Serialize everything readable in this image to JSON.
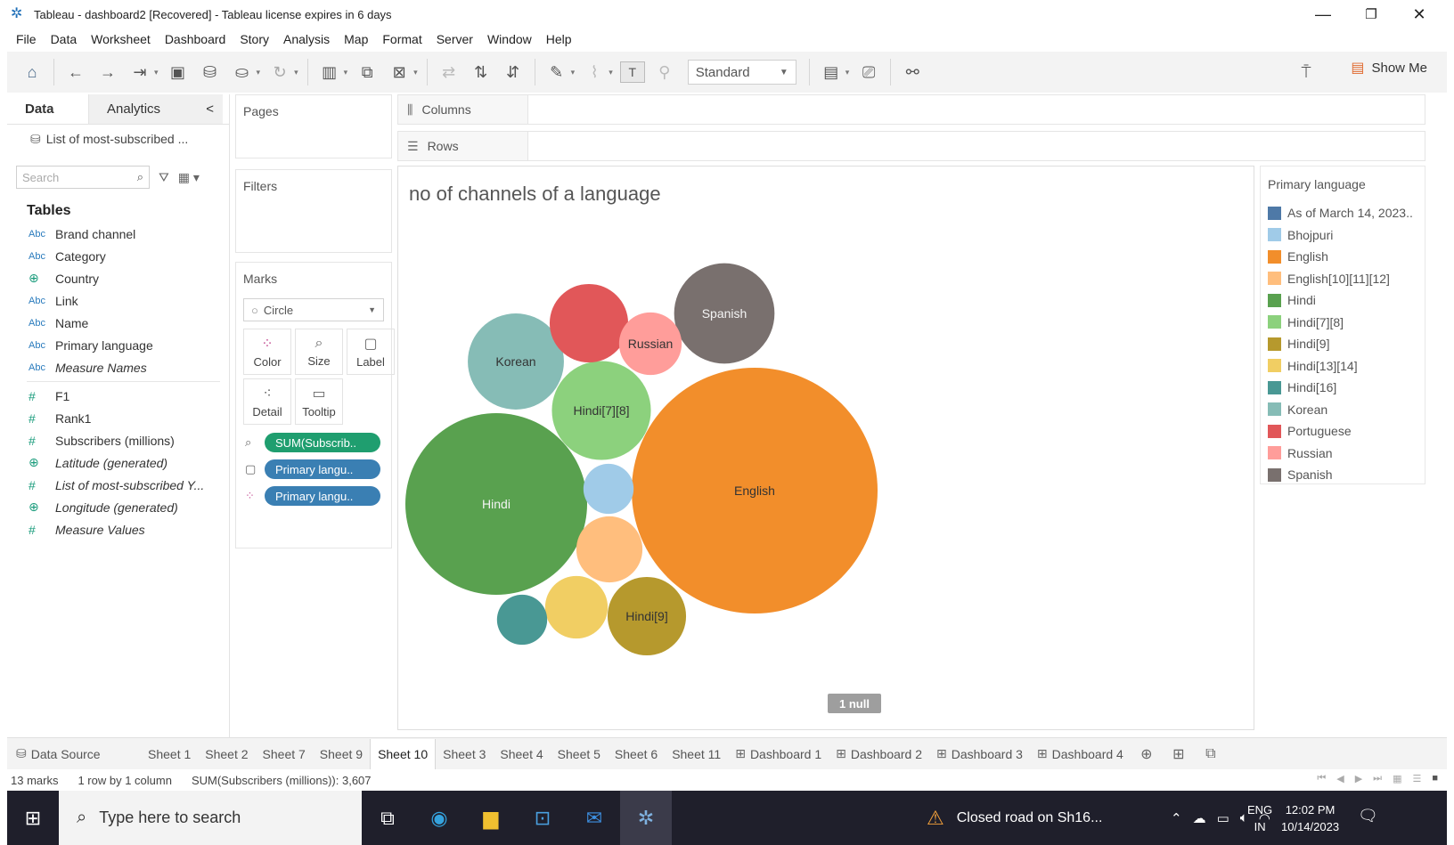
{
  "window": {
    "title": "Tableau - dashboard2 [Recovered] - Tableau license expires in 6 days",
    "app_icon": "tableau-logo-icon",
    "controls": [
      "—",
      "❐",
      "✕"
    ]
  },
  "menu": [
    "File",
    "Data",
    "Worksheet",
    "Dashboard",
    "Story",
    "Analysis",
    "Map",
    "Format",
    "Server",
    "Window",
    "Help"
  ],
  "toolbar": {
    "fit_select": "Standard",
    "show_me": "Show Me"
  },
  "data_pane": {
    "tab_data": "Data",
    "tab_analytics": "Analytics",
    "collapse_glyph": "<",
    "datasource": "List of most-subscribed ...",
    "search_placeholder": "Search",
    "tables_heading": "Tables",
    "dimensions": [
      {
        "type": "Abc",
        "name": "Brand channel",
        "italic": false
      },
      {
        "type": "Abc",
        "name": "Category",
        "italic": false
      },
      {
        "type": "globe",
        "name": "Country",
        "italic": false
      },
      {
        "type": "Abc",
        "name": "Link",
        "italic": false
      },
      {
        "type": "Abc",
        "name": "Name",
        "italic": false
      },
      {
        "type": "Abc",
        "name": "Primary language",
        "italic": false
      },
      {
        "type": "Abc",
        "name": "Measure Names",
        "italic": true
      }
    ],
    "measures": [
      {
        "type": "#",
        "name": "F1",
        "italic": false
      },
      {
        "type": "#",
        "name": "Rank1",
        "italic": false
      },
      {
        "type": "#",
        "name": "Subscribers (millions)",
        "italic": false
      },
      {
        "type": "globe",
        "name": "Latitude (generated)",
        "italic": true
      },
      {
        "type": "#",
        "name": "List of most-subscribed Y...",
        "italic": true
      },
      {
        "type": "globe",
        "name": "Longitude (generated)",
        "italic": true
      },
      {
        "type": "#",
        "name": "Measure Values",
        "italic": true
      }
    ]
  },
  "cards": {
    "pages": "Pages",
    "filters": "Filters",
    "marks": "Marks",
    "mark_type": "Circle",
    "mark_buttons": [
      {
        "label": "Color",
        "icon": "color-dots-icon"
      },
      {
        "label": "Size",
        "icon": "size-icon"
      },
      {
        "label": "Label",
        "icon": "label-icon"
      },
      {
        "label": "Detail",
        "icon": "detail-icon"
      },
      {
        "label": "Tooltip",
        "icon": "tooltip-icon"
      }
    ],
    "pills": [
      {
        "label": "SUM(Subscrib..",
        "color": "green",
        "icon": "size-icon"
      },
      {
        "label": "Primary langu..",
        "color": "blue",
        "icon": "label-icon"
      },
      {
        "label": "Primary langu..",
        "color": "blue",
        "icon": "color-dots-icon"
      }
    ]
  },
  "shelves": {
    "columns": "Columns",
    "rows": "Rows"
  },
  "viz": {
    "title": "no of channels of a language",
    "null_indicator": "1 null"
  },
  "chart_data": {
    "type": "packed-bubble",
    "title": "no of channels of a language",
    "size_measure": "SUM(Subscribers (millions))",
    "color_dimension": "Primary language",
    "total": 3607,
    "bubbles": [
      {
        "language": "English",
        "label": "English",
        "value": 1080,
        "color": "#f28e2b"
      },
      {
        "language": "Hindi",
        "label": "Hindi",
        "value": 590,
        "color": "#59a14f"
      },
      {
        "language": "Hindi[7][8]",
        "label": "Hindi[7][8]",
        "value": 175,
        "color": "#8cd17d"
      },
      {
        "language": "Korean",
        "label": "Korean",
        "value": 165,
        "color": "#86bcb6"
      },
      {
        "language": "Spanish",
        "label": "Spanish",
        "value": 180,
        "color": "#79706e"
      },
      {
        "language": "Hindi[9]",
        "label": "Hindi[9]",
        "value": 110,
        "color": "#b6992d"
      },
      {
        "language": "Portuguese",
        "label": "",
        "value": 110,
        "color": "#e15759"
      },
      {
        "language": "English[10][11][12]",
        "label": "",
        "value": 78,
        "color": "#ffbe7d"
      },
      {
        "language": "Russian",
        "label": "Russian",
        "value": 70,
        "color": "#ff9d9a"
      },
      {
        "language": "Hindi[13][14]",
        "label": "",
        "value": 70,
        "color": "#f1ce63"
      },
      {
        "language": "Hindi[16]",
        "label": "",
        "value": 45,
        "color": "#499894"
      },
      {
        "language": "Bhojpuri",
        "label": "",
        "value": 45,
        "color": "#a0cbe8"
      }
    ]
  },
  "legend": {
    "title": "Primary language",
    "items": [
      {
        "label": "As of March 14, 2023..",
        "color": "#4e79a7"
      },
      {
        "label": "Bhojpuri",
        "color": "#a0cbe8"
      },
      {
        "label": "English",
        "color": "#f28e2b"
      },
      {
        "label": "English[10][11][12]",
        "color": "#ffbe7d"
      },
      {
        "label": "Hindi",
        "color": "#59a14f"
      },
      {
        "label": "Hindi[7][8]",
        "color": "#8cd17d"
      },
      {
        "label": "Hindi[9]",
        "color": "#b6992d"
      },
      {
        "label": "Hindi[13][14]",
        "color": "#f1ce63"
      },
      {
        "label": "Hindi[16]",
        "color": "#499894"
      },
      {
        "label": "Korean",
        "color": "#86bcb6"
      },
      {
        "label": "Portuguese",
        "color": "#e15759"
      },
      {
        "label": "Russian",
        "color": "#ff9d9a"
      },
      {
        "label": "Spanish",
        "color": "#79706e"
      }
    ]
  },
  "sheet_tabs": {
    "data_source": "Data Source",
    "sheets": [
      "Sheet 1",
      "Sheet 2",
      "Sheet 7",
      "Sheet 9",
      "Sheet 10",
      "Sheet 3",
      "Sheet 4",
      "Sheet 5",
      "Sheet 6",
      "Sheet 11"
    ],
    "active": "Sheet 10",
    "dashboards": [
      "Dashboard 1",
      "Dashboard 2",
      "Dashboard 3",
      "Dashboard 4"
    ]
  },
  "status": {
    "marks": "13 marks",
    "dims": "1 row by 1 column",
    "sum": "SUM(Subscribers (millions)): 3,607"
  },
  "taskbar": {
    "search_placeholder": "Type here to search",
    "news": "Closed road on Sh16...",
    "lang_top": "ENG",
    "lang_bottom": "IN",
    "time": "12:02 PM",
    "date": "10/14/2023"
  }
}
